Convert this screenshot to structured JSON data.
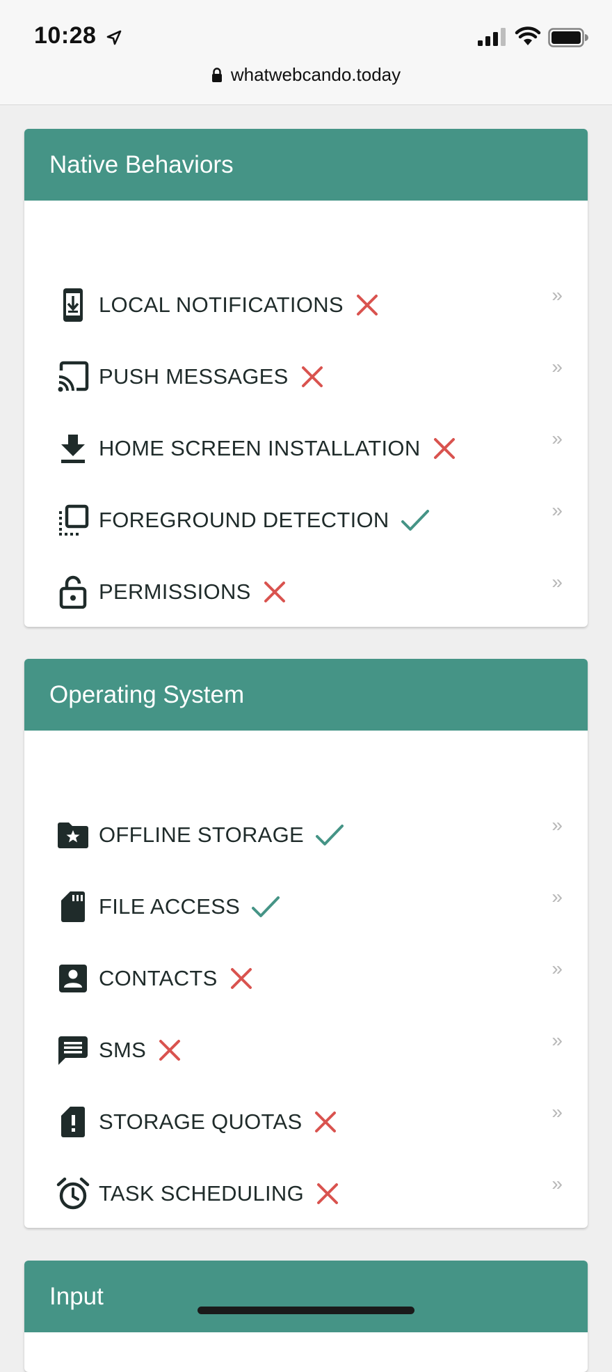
{
  "status_bar": {
    "time": "10:28",
    "url": "whatwebcando.today"
  },
  "colors": {
    "header_bg": "#459486",
    "cross": "#d9534f",
    "check": "#459486"
  },
  "sections": [
    {
      "title": "Native Behaviors",
      "items": [
        {
          "label": "LOCAL NOTIFICATIONS",
          "icon": "phone-download-icon",
          "status": "unsupported",
          "chevron": "»"
        },
        {
          "label": "PUSH MESSAGES",
          "icon": "cast-icon",
          "status": "unsupported",
          "chevron": "»"
        },
        {
          "label": "HOME SCREEN INSTALLATION",
          "icon": "download-icon",
          "status": "unsupported",
          "chevron": "»"
        },
        {
          "label": "FOREGROUND DETECTION",
          "icon": "select-all-icon",
          "status": "supported",
          "chevron": "»"
        },
        {
          "label": "PERMISSIONS",
          "icon": "lock-open-icon",
          "status": "unsupported",
          "chevron": "»"
        }
      ]
    },
    {
      "title": "Operating System",
      "items": [
        {
          "label": "OFFLINE STORAGE",
          "icon": "folder-star-icon",
          "status": "supported",
          "chevron": "»"
        },
        {
          "label": "FILE ACCESS",
          "icon": "sd-card-icon",
          "status": "supported",
          "chevron": "»"
        },
        {
          "label": "CONTACTS",
          "icon": "contact-icon",
          "status": "unsupported",
          "chevron": "»"
        },
        {
          "label": "SMS",
          "icon": "message-icon",
          "status": "unsupported",
          "chevron": "»"
        },
        {
          "label": "STORAGE QUOTAS",
          "icon": "sim-alert-icon",
          "status": "unsupported",
          "chevron": "»"
        },
        {
          "label": "TASK SCHEDULING",
          "icon": "alarm-icon",
          "status": "unsupported",
          "chevron": "»"
        }
      ]
    },
    {
      "title": "Input",
      "items": []
    }
  ]
}
